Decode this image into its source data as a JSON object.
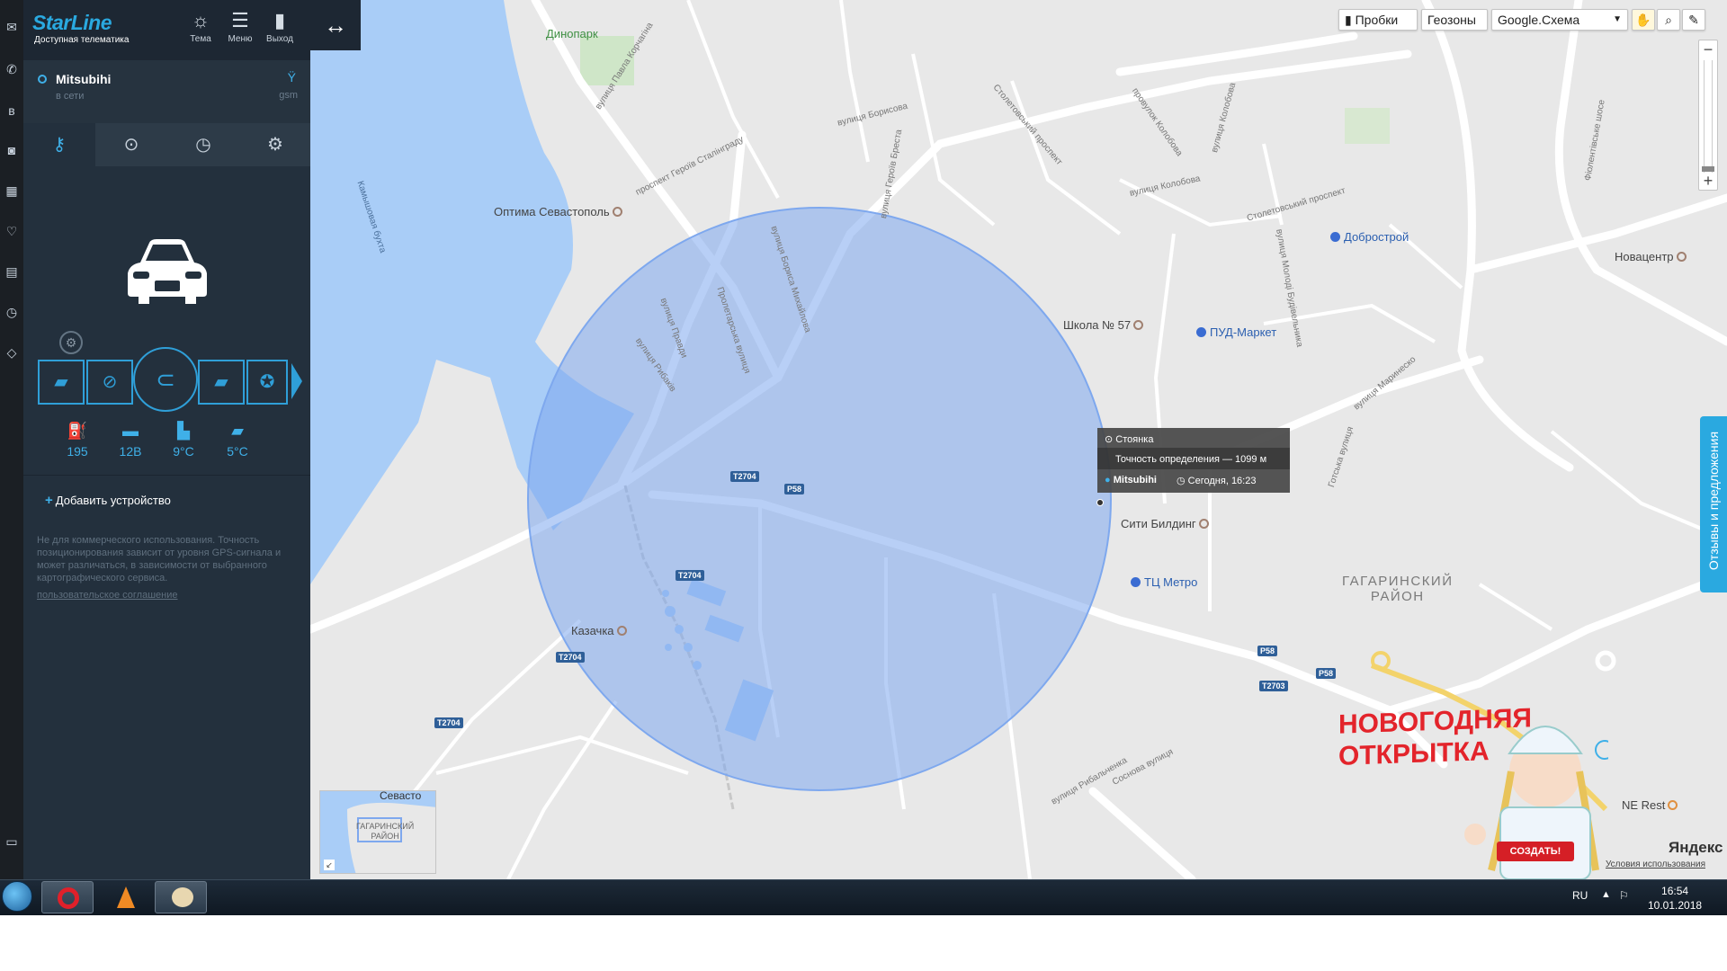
{
  "sidebar": {
    "logo": "StarLine",
    "tagline": "Доступная телематика",
    "header_buttons": [
      {
        "label": "Тема",
        "icon": "sun-icon"
      },
      {
        "label": "Меню",
        "icon": "menu-icon"
      },
      {
        "label": "Выход",
        "icon": "exit-door-icon"
      }
    ],
    "device": {
      "name": "Mitsubihi",
      "status": "в сети",
      "signal": "gsm"
    },
    "tabs": [
      {
        "icon": "key-icon",
        "active": true
      },
      {
        "icon": "location-pin-icon",
        "active": false
      },
      {
        "icon": "clock-icon",
        "active": false
      },
      {
        "icon": "gear-icon",
        "active": false
      }
    ],
    "stats": [
      {
        "icon": "fuel-gauge-icon",
        "value": "195"
      },
      {
        "icon": "battery-icon",
        "value": "12В"
      },
      {
        "icon": "car-interior-icon",
        "value": "9°C"
      },
      {
        "icon": "engine-icon",
        "value": "5°C"
      }
    ],
    "add_device": "Добавить устройство",
    "notice": "Не для коммерческого использования. Точность позиционирования зависит от уровня GPS-сигнала и может различаться, в зависимости от выбранного картографического сервиса.",
    "agreement_link": "пользовательское соглашение"
  },
  "map": {
    "toolbar": {
      "traffic": "Пробки",
      "geozones": "Геозоны",
      "map_type": "Google.Схема"
    },
    "feedback": "Отзывы и предложения",
    "popup": {
      "title": "Стоянка",
      "accuracy": "Точность определения — 1099 м",
      "device": "Mitsubihi",
      "time": "Сегодня, 16:23"
    },
    "labels": {
      "dinopark": "Динопарк",
      "optima": "Оптима Севастополь",
      "kazachka": "Казачка",
      "school": "Школа № 57",
      "pud": "ПУД-Маркет",
      "city_building": "Сити Билдинг",
      "tc_metro": "ТЦ Метро",
      "dobrostroy": "Добрострой",
      "novacenter": "Новацентр",
      "ne_rest": "NE Rest",
      "district_line1": "ГАГАРИНСКИЙ",
      "district_line2": "РАЙОН",
      "bay": "Камышовая бухта",
      "st_pavla": "вулиця Павла Корчагіна",
      "st_borisova": "вулиця Борисова",
      "st_geroev": "проспект Героїв Сталінграду",
      "st_brest": "вулиця Героїв Бреста",
      "st_mikhailova": "вулиця Бориса Михайлова",
      "st_stol": "Столетовський проспект",
      "st_kolobova": "вулиця Колобова",
      "st_kol2": "провулок Колобова",
      "st_kol3": "вулиця Колобова",
      "st_stol2": "Столетовський проспект",
      "st_fiol": "Фіолентівське шосе",
      "st_proletar": "Пролетарська вулиця",
      "st_pravdy": "вулиця Правди",
      "st_rybakiv": "вулиця Рибаків",
      "st_molodi": "вулиця Молоді Будівельника",
      "st_gotska": "Готська вулиця",
      "st_marinesko": "вулиця Маринеско",
      "st_rybalchenka": "вулиця Рибальченка",
      "st_sosnova": "Соснова вулиця"
    },
    "road_shields": [
      "T2704",
      "P58",
      "T2704",
      "T2704",
      "T2704",
      "P58",
      "T2703",
      "P58"
    ],
    "minimap": {
      "top": "Севасто",
      "line1": "ГАГАРИНСКИЙ",
      "line2": "РАЙОН"
    },
    "ad": {
      "line1": "НОВОГОДНЯЯ",
      "line2": "ОТКРЫТКА",
      "button": "СОЗДАТЬ!"
    },
    "brand": "Яндекс",
    "terms": "Условия использования"
  },
  "taskbar": {
    "lang": "RU",
    "time": "16:54",
    "date": "10.01.2018"
  },
  "colors": {
    "accent": "#2aa9e0",
    "sidebar_bg": "#23303d",
    "accuracy_circle": "#7ea8ee",
    "water": "#a9cdf7"
  }
}
